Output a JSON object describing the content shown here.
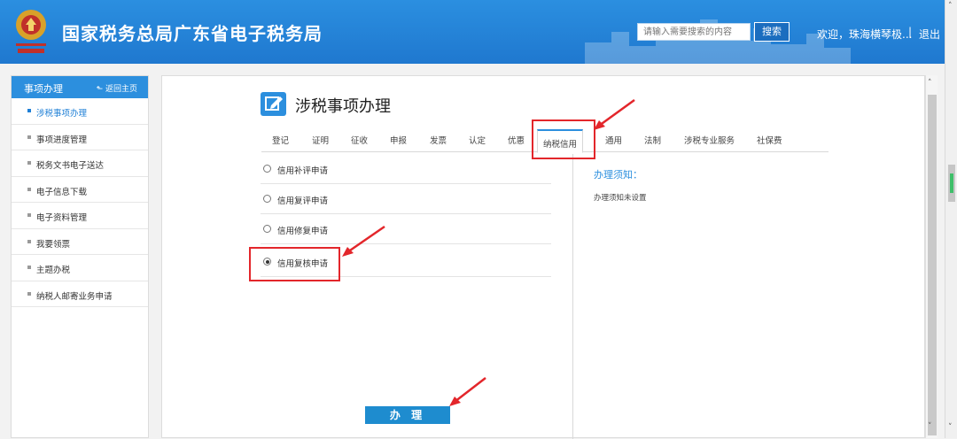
{
  "header": {
    "title": "国家税务总局广东省电子税务局",
    "search_placeholder": "请输入需要搜索的内容",
    "search_button": "搜索",
    "welcome": "欢迎，珠海横琴极...",
    "separator": "|",
    "logout": "退出"
  },
  "sidebar": {
    "title": "事项办理",
    "back_label": "返回主页",
    "items": [
      {
        "label": "涉税事项办理"
      },
      {
        "label": "事项进度管理"
      },
      {
        "label": "税务文书电子送达"
      },
      {
        "label": "电子信息下载"
      },
      {
        "label": "电子资料管理"
      },
      {
        "label": "我要领票"
      },
      {
        "label": "主题办税"
      },
      {
        "label": "纳税人邮寄业务申请"
      }
    ],
    "active_index": 0
  },
  "main": {
    "title": "涉税事项办理",
    "tabs": [
      {
        "label": "登记"
      },
      {
        "label": "证明"
      },
      {
        "label": "征收"
      },
      {
        "label": "申报"
      },
      {
        "label": "发票"
      },
      {
        "label": "认定"
      },
      {
        "label": "优惠"
      },
      {
        "label": "纳税信用"
      },
      {
        "label": "通用"
      },
      {
        "label": "法制"
      },
      {
        "label": "涉税专业服务"
      },
      {
        "label": "社保费"
      }
    ],
    "active_tab": "纳税信用",
    "options": [
      {
        "label": "信用补评申请",
        "selected": false
      },
      {
        "label": "信用复评申请",
        "selected": false
      },
      {
        "label": "信用修复申请",
        "selected": false
      },
      {
        "label": "信用复核申请",
        "selected": true
      }
    ],
    "notice_title": "办理须知：",
    "notice_body": "办理须知未设置",
    "submit_button": "办 理"
  },
  "colors": {
    "header_blue": "#2284d8",
    "accent_blue": "#2c8fde",
    "button_blue": "#1e8ccf",
    "highlight_red": "#e3262b"
  },
  "icons": [
    "emblem-icon",
    "back-arrow-icon",
    "edit-icon",
    "scroll-up-icon",
    "scroll-down-icon"
  ]
}
